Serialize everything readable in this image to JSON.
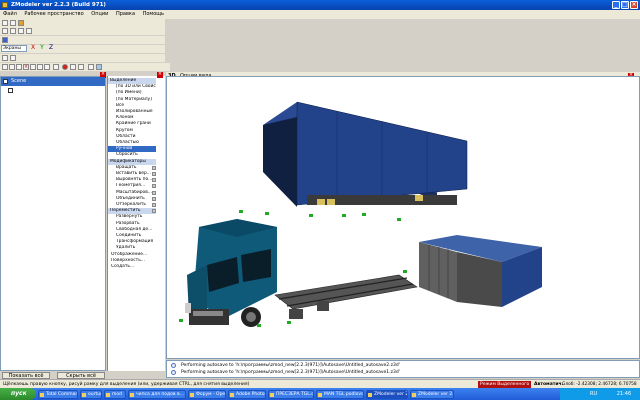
{
  "window": {
    "title": "ZModeler ver 2.2.3 (Build 971)"
  },
  "menu": [
    "Файл",
    "Рабочее пространство",
    "Опции",
    "Правка",
    "Помощь"
  ],
  "toolbar": {
    "mode_select": "Экраны"
  },
  "tree": {
    "root_label": "Scene"
  },
  "left_buttons": {
    "show_all": "Показать всё",
    "hide_all": "Скрыть всё"
  },
  "commands": {
    "header_select": "Выделение",
    "select_items": [
      "[по 3D или Свойс...",
      "[по Имени]",
      "[по Материалу]",
      "Всё",
      "Изолированные",
      "Клоном",
      "Крайние грани",
      "Кругом",
      "Области",
      "Областью",
      "Ручной",
      "Сбросить"
    ],
    "header_modify": "Модификаторы",
    "modify_items": [
      "Вращать",
      "Вставить вер...",
      "Выровнять по...",
      "Геометрия...",
      "Масштабиров...",
      "Объединить",
      "Отзеркалить",
      "Переместить",
      "Развернуть",
      "Разорвать",
      "Свободная де...",
      "Соединить",
      "Трансформация",
      "Удалить"
    ],
    "extra_items": [
      "Отображение...",
      "Поверхность...",
      "Создать..."
    ]
  },
  "viewport": {
    "tab_3d": "3D",
    "tab_label": "Опции вида"
  },
  "console": {
    "lines": [
      "Performing autosave to 'h:\\программы\\zmod_new[2.2.3(971)]\\Autosave\\Untitled_autosave2.z3d'",
      "Performing autosave to 'h:\\программы\\zmod_new[2.2.3(971)]\\Autosave\\Untitled_autosave1.z3d'"
    ]
  },
  "status": {
    "hint": "Щёлкаешь правую кнопку, рисуй рамку для выделения (или, удерживая CTRL, для снятия выделения)",
    "mode": "Режим Выделенного",
    "auto": "Автоматич.",
    "coords": "Gлоб: -2.42308; 2.46728; 6.70758"
  },
  "taskbar": {
    "start": "пуск",
    "tasks": [
      "Total Commander",
      "ourtug",
      "mod",
      "чипса для подов в...",
      "Форум - Opera",
      "Adobe Photoshop -...",
      "ПРЕСЗЕРА TGL.oxe...",
      "MAN TGL podlovosc...",
      "ZModeler ver 2.2.3 (...",
      "ZModeler ver 2.2.3 (..."
    ],
    "lang": "RU",
    "clock": "21:46"
  },
  "colors": {
    "titlebar": "#0a5fd8",
    "cab": "#0e5a78",
    "trailer": "#22428a",
    "selection": "#316ac5"
  }
}
